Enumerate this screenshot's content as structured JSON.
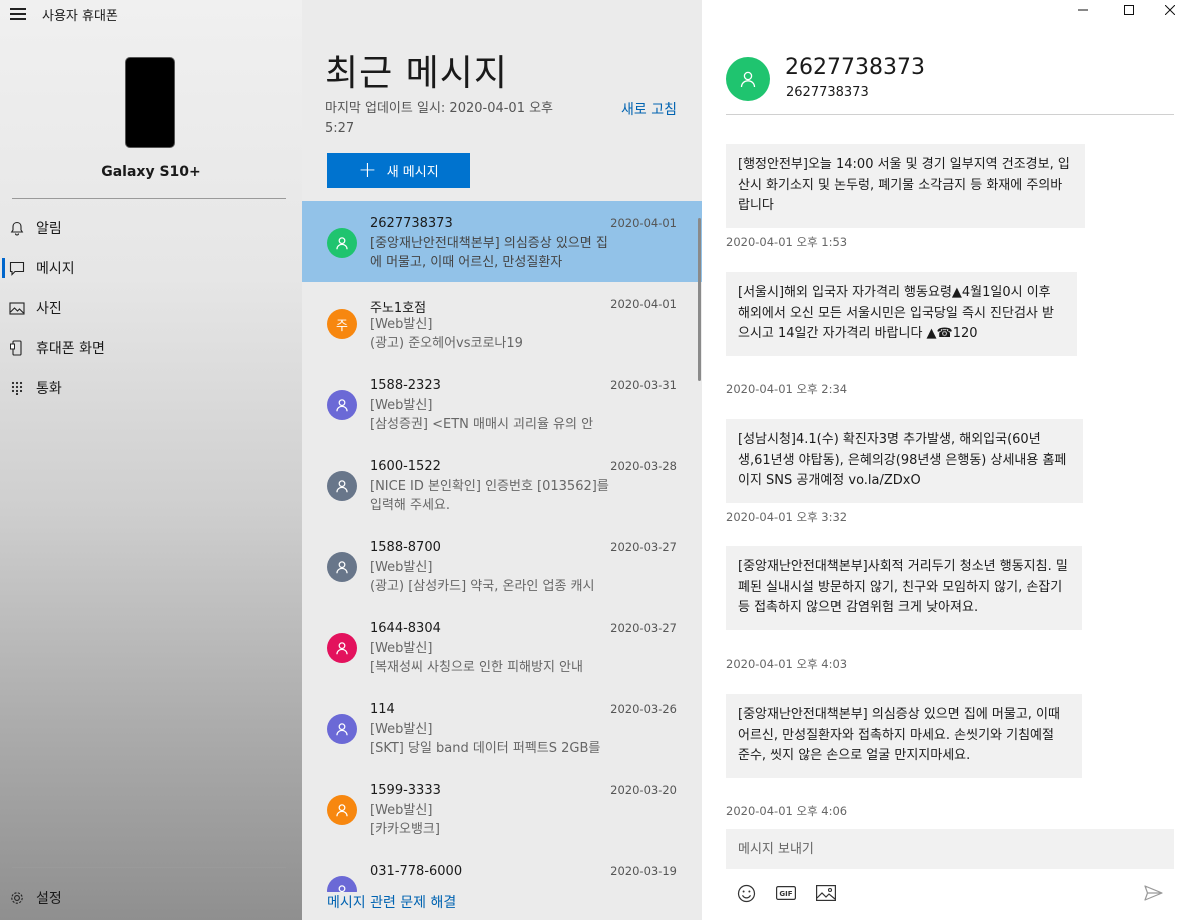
{
  "app": {
    "title": "사용자 휴대폰"
  },
  "device": {
    "name": "Galaxy S10+"
  },
  "nav": {
    "items": [
      {
        "label": "알림",
        "icon": "bell-icon"
      },
      {
        "label": "메시지",
        "icon": "chat-icon",
        "selected": true
      },
      {
        "label": "사진",
        "icon": "photo-icon"
      },
      {
        "label": "휴대폰 화면",
        "icon": "phone-screen-icon"
      },
      {
        "label": "통화",
        "icon": "dialpad-icon"
      }
    ],
    "settings_label": "설정"
  },
  "messages": {
    "title": "최근 메시지",
    "last_updated": "마지막 업데이트 일시: 2020-04-01 오후 5:27",
    "refresh_label": "새로 고침",
    "new_message_label": "새 메시지",
    "troubleshoot_label": "메시지 관련 문제 해결",
    "conversations": [
      {
        "name": "2627738373",
        "date": "2020-04-01",
        "preview": "[중앙재난안전대책본부] 의심증상 있으면 집에 머물고, 이때 어르신, 만성질환자",
        "avatar": "",
        "color": "#1fc46f",
        "selected": true
      },
      {
        "name": "주노1호점",
        "date": "2020-04-01",
        "preview": "[Web발신]\n(광고) 준오헤어vs코로나19",
        "avatar": "주",
        "color": "#f7870f"
      },
      {
        "name": "1588-2323",
        "date": "2020-03-31",
        "preview": "[Web발신]\n[삼성증권] <ETN 매매시 괴리율 유의 안",
        "avatar": "",
        "color": "#6b69d6"
      },
      {
        "name": "1600-1522",
        "date": "2020-03-28",
        "preview": "[NICE ID 본인확인] 인증번호 [013562]를 입력해 주세요.",
        "avatar": "",
        "color": "#68768a"
      },
      {
        "name": "1588-8700",
        "date": "2020-03-27",
        "preview": "[Web발신]\n(광고) [삼성카드] 약국, 온라인 업종 캐시",
        "avatar": "",
        "color": "#68768a"
      },
      {
        "name": "1644-8304",
        "date": "2020-03-27",
        "preview": "[Web발신]\n[복재성씨 사칭으로 인한 피해방지 안내",
        "avatar": "",
        "color": "#e3125d"
      },
      {
        "name": "114",
        "date": "2020-03-26",
        "preview": "[Web발신]\n[SKT] 당일 band 데이터 퍼펙트S 2GB를",
        "avatar": "",
        "color": "#6b69d6"
      },
      {
        "name": "1599-3333",
        "date": "2020-03-20",
        "preview": "[Web발신]\n[카카오뱅크]",
        "avatar": "",
        "color": "#f7870f"
      },
      {
        "name": "031-778-6000",
        "date": "2020-03-19",
        "preview": "",
        "avatar": "",
        "color": "#6b69d6"
      }
    ]
  },
  "conversation": {
    "name": "2627738373",
    "number": "2627738373",
    "messages": [
      {
        "text": "[행정안전부]오늘 14:00 서울 및 경기 일부지역 건조경보, 입산시 화기소지 및 논두렁, 폐기물 소각금지 등 화재에 주의바랍니다",
        "time": "2020-04-01 오후 1:53"
      },
      {
        "text": "[서울시]해외 입국자 자가격리 행동요령▲4월1일0시 이후 해외에서 오신 모든 서울시민은 입국당일 즉시 진단검사 받으시고 14일간 자가격리 바랍니다 ▲☎120",
        "time": "2020-04-01 오후 2:34"
      },
      {
        "text": "[성남시청]4.1(수) 확진자3명 추가발생, 해외입국(60년생,61년생 야탑동), 은혜의강(98년생 은행동) 상세내용 홈페이지 SNS 공개예정 vo.la/ZDxO",
        "time": "2020-04-01 오후 3:32"
      },
      {
        "text": "[중앙재난안전대책본부]사회적 거리두기 청소년 행동지침. 밀폐된 실내시설 방문하지 않기, 친구와 모임하지 않기, 손잡기 등 접촉하지 않으면 감염위험 크게 낮아져요.",
        "time": "2020-04-01 오후 4:03"
      },
      {
        "text": "[중앙재난안전대책본부] 의심증상 있으면 집에 머물고, 이때 어르신, 만성질환자와 접촉하지 마세요. 손씻기와 기침예절 준수, 씻지 않은 손으로 얼굴 만지지마세요.",
        "time": "2020-04-01 오후 4:06"
      }
    ],
    "compose_placeholder": "메시지 보내기"
  }
}
